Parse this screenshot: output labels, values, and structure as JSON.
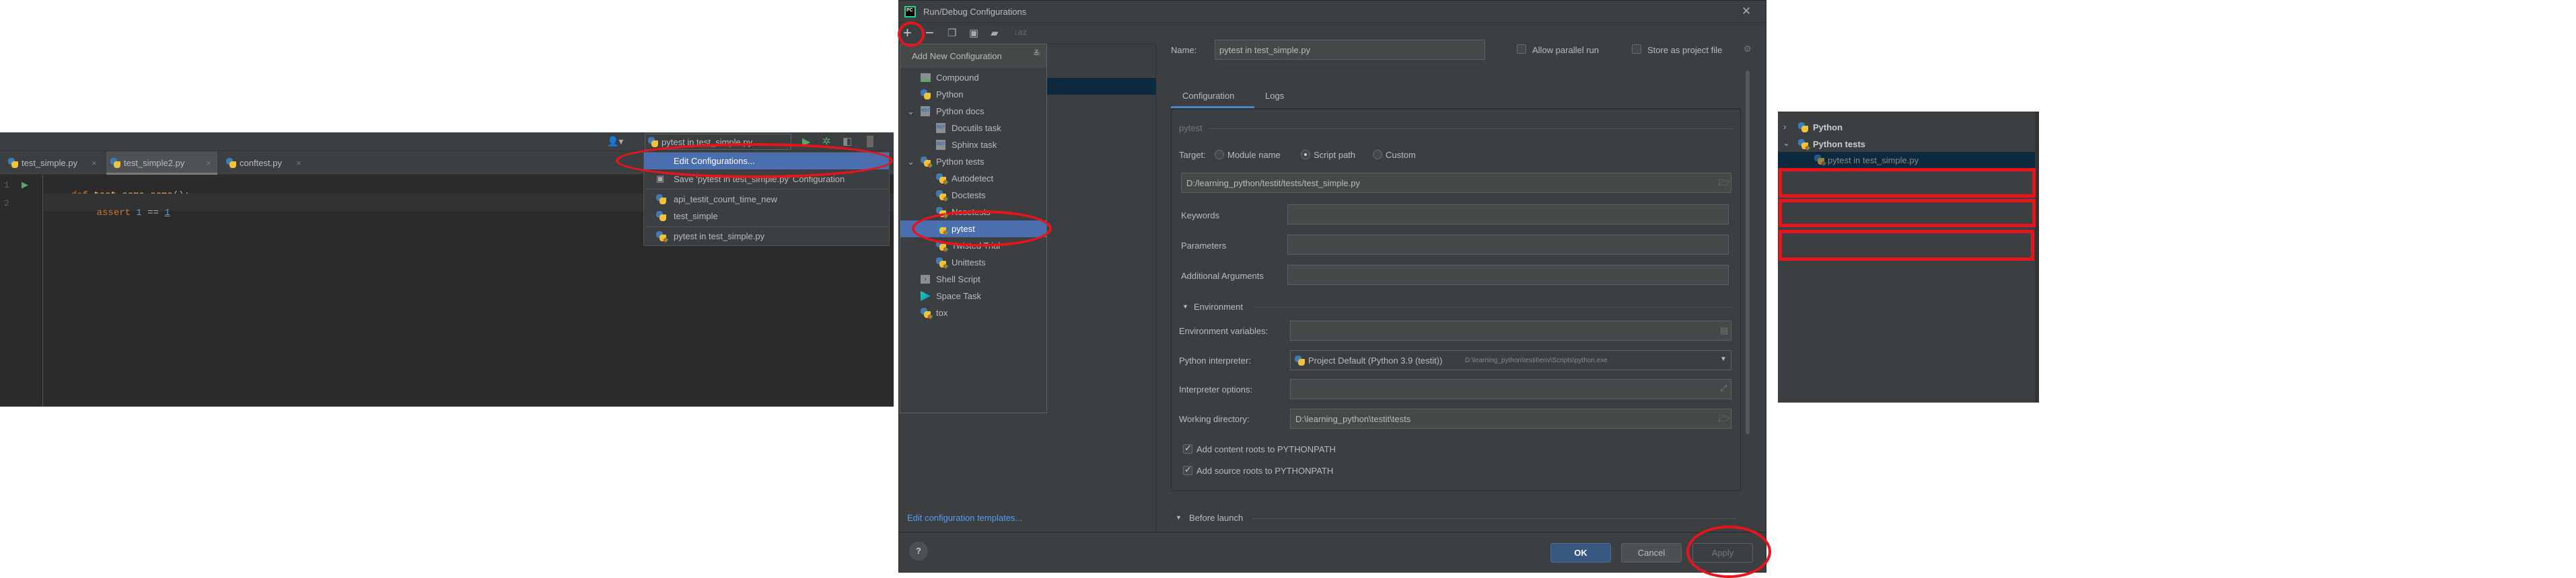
{
  "editor": {
    "run_config": "pytest in test_simple.py",
    "tabs": [
      {
        "label": "test_simple.py"
      },
      {
        "label": "test_simple2.py"
      },
      {
        "label": "conftest.py"
      }
    ],
    "active_tab": 1,
    "lines": [
      {
        "num": "1",
        "kw": "def ",
        "fn": "test_some_some",
        "rest": "():"
      },
      {
        "num": "2",
        "kw": "assert ",
        "a": "1",
        "op": " == ",
        "b": "1"
      }
    ],
    "menu": {
      "edit": "Edit Configurations...",
      "save": "Save 'pytest in test_simple.py' Configuration",
      "items": [
        {
          "label": "api_testit_count_time_new"
        },
        {
          "label": "test_simple"
        },
        {
          "label": "pytest in test_simple.py"
        }
      ]
    }
  },
  "dialog": {
    "title": "Run/Debug Configurations",
    "add_popup": {
      "header": "Add New Configuration",
      "items": [
        {
          "label": "Compound"
        },
        {
          "label": "Python"
        },
        {
          "label": "Python docs"
        },
        {
          "label": "Docutils task"
        },
        {
          "label": "Sphinx task"
        },
        {
          "label": "Python tests"
        },
        {
          "label": "Autodetect"
        },
        {
          "label": "Doctests"
        },
        {
          "label": "Nosetests"
        },
        {
          "label": "pytest"
        },
        {
          "label": "Twisted Trial"
        },
        {
          "label": "Unittests"
        },
        {
          "label": "Shell Script"
        },
        {
          "label": "Space Task"
        },
        {
          "label": "tox"
        }
      ],
      "selected": "pytest"
    },
    "templates_link": "Edit configuration templates...",
    "name_label": "Name:",
    "name_value": "pytest in test_simple.py",
    "allow_parallel": {
      "label": "Allow parallel run",
      "checked": false
    },
    "store_project": {
      "label": "Store as project file",
      "checked": false
    },
    "tabs": [
      {
        "label": "Configuration"
      },
      {
        "label": "Logs"
      }
    ],
    "group": "pytest",
    "target_label": "Target:",
    "targets": [
      {
        "label": "Module name",
        "checked": false
      },
      {
        "label": "Script path",
        "checked": true
      },
      {
        "label": "Custom",
        "checked": false
      }
    ],
    "script_path": "D:/learning_python/testit/tests/test_simple.py",
    "keywords_label": "Keywords",
    "parameters_label": "Parameters",
    "additional_label": "Additional Arguments",
    "environment": "Environment",
    "env_vars_label": "Environment variables:",
    "interpreter_label": "Python interpreter:",
    "interpreter_value": "Project Default (Python 3.9 (testit))",
    "interpreter_path": "D:\\learning_python\\testit\\env\\Scripts\\python.exe",
    "interp_options_label": "Interpreter options:",
    "workdir_label": "Working directory:",
    "workdir_value": "D:\\learning_python\\testit\\tests",
    "content_roots": {
      "label": "Add content roots to PYTHONPATH",
      "checked": true
    },
    "source_roots": {
      "label": "Add source roots to PYTHONPATH",
      "checked": true
    },
    "before_launch": "Before launch",
    "ok": "OK",
    "cancel": "Cancel",
    "apply": "Apply"
  },
  "tree_panel": {
    "items": [
      {
        "label": "Python"
      },
      {
        "label": "Python tests"
      },
      {
        "label": "pytest in test_simple.py"
      }
    ]
  },
  "colors": {
    "annotation": "#e8141c",
    "accent": "#4b6eaf",
    "selection": "#0d293e",
    "link": "#589df6"
  }
}
